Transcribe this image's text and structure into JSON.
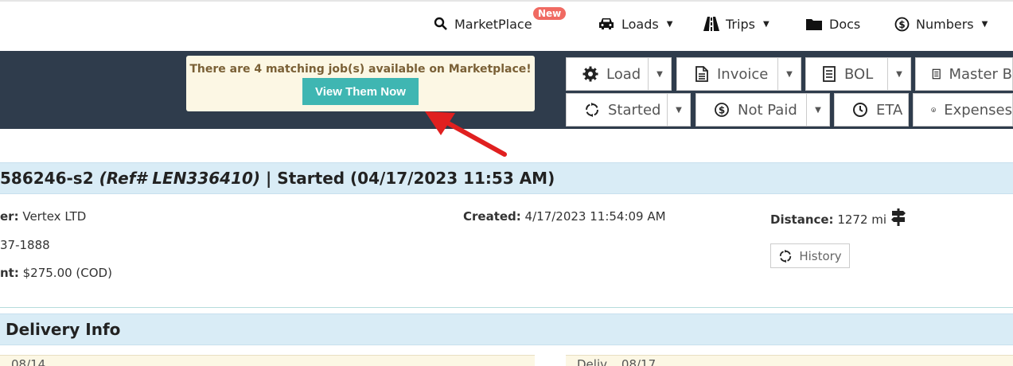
{
  "nav": {
    "marketplace": "MarketPlace",
    "new_badge": "New",
    "loads": "Loads",
    "trips": "Trips",
    "docs": "Docs",
    "numbers": "Numbers",
    "caret": "▼"
  },
  "alert": {
    "text": "There are 4 matching job(s) available on Marketplace!",
    "button": "View Them Now"
  },
  "toolbar": {
    "row1": [
      "Load",
      "Invoice",
      "BOL",
      "Master B"
    ],
    "row2": [
      "Started",
      "Not Paid",
      "ETA",
      "Expenses"
    ]
  },
  "load": {
    "id_fragment": "586246-s2 ",
    "ref": "(Ref# LEN336410)",
    "status": " | Started (04/17/2023 11:53 AM)",
    "customer_label": "er:",
    "customer": " Vertex LTD",
    "phone": "37-1888",
    "payment_label": "nt:",
    "payment": " $275.00 (COD)",
    "created_label": "Created:",
    "created": " 4/17/2023 11:54:09 AM",
    "distance_label": "Distance:",
    "distance": " 1272 mi",
    "history_button": "History"
  },
  "delivery": {
    "title": " Delivery Info",
    "pickup_fragment": "08/14",
    "delivery_fragment": "Deliv... 08/17"
  },
  "colors": {
    "dark_bar": "#2f3c4c",
    "alert_bg": "#fcf7e4",
    "cta": "#3fb6b2",
    "arrow": "#e02020",
    "badge": "#f06a62"
  }
}
